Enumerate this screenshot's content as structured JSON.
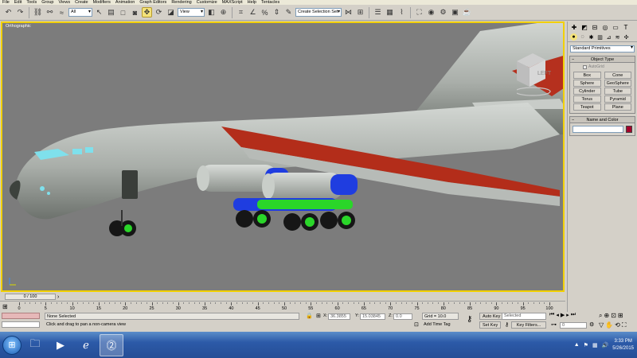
{
  "menu": [
    "File",
    "Edit",
    "Tools",
    "Group",
    "Views",
    "Create",
    "Modifiers",
    "Animation",
    "Graph Editors",
    "Rendering",
    "Customize",
    "MAXScript",
    "Help",
    "Tentacles"
  ],
  "toolbar": {
    "selection_filter": "All",
    "reference_coord": "View",
    "named_selection_set": "Create Selection Set"
  },
  "viewport": {
    "label": "Orthographic",
    "viewcube_face": "LEFT"
  },
  "command_panel": {
    "category_dropdown": "Standard Primitives",
    "object_type_title": "Object Type",
    "autogrid_label": "AutoGrid",
    "buttons": [
      "Box",
      "Cone",
      "Sphere",
      "GeoSphere",
      "Cylinder",
      "Tube",
      "Torus",
      "Pyramid",
      "Teapot",
      "Plane"
    ],
    "name_color_title": "Name and Color",
    "object_color": "#a5002a"
  },
  "timeline": {
    "frame_counter": "0 / 100",
    "ticks": [
      "0",
      "5",
      "10",
      "15",
      "20",
      "25",
      "30",
      "35",
      "40",
      "45",
      "50",
      "55",
      "60",
      "65",
      "70",
      "75",
      "80",
      "85",
      "90",
      "95",
      "100"
    ]
  },
  "status": {
    "selection_text": "None Selected",
    "prompt_text": "Click and drag to pan a non-camera view",
    "x_label": "X:",
    "x_value": "36.3855",
    "y_label": "Y:",
    "y_value": "15.03845",
    "z_label": "Z:",
    "z_value": "0.0",
    "grid": "Grid = 10.0",
    "add_time_tag": "Add Time Tag",
    "auto_key": "Auto Key",
    "set_key": "Set Key",
    "key_mode_select": "Selected",
    "key_filters": "Key Filters...",
    "current_frame": "0"
  },
  "taskbar": {
    "time": "3:33 PM",
    "date": "5/26/2015"
  }
}
